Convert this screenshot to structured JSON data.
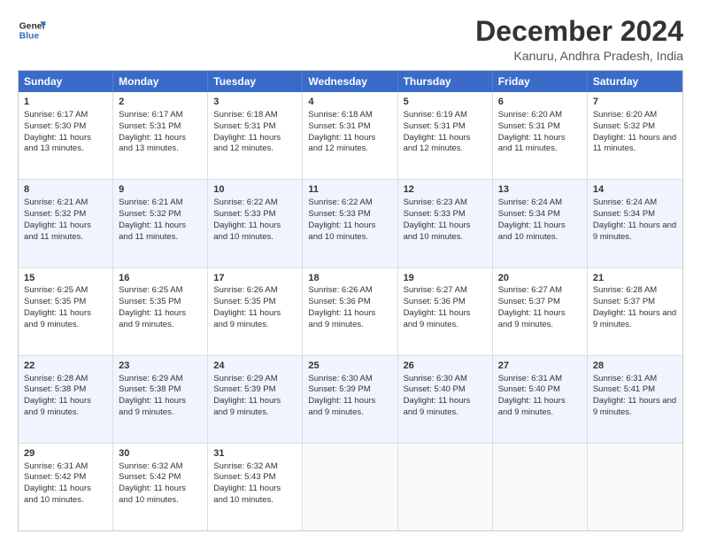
{
  "logo": {
    "line1": "General",
    "line2": "Blue"
  },
  "title": "December 2024",
  "subtitle": "Kanuru, Andhra Pradesh, India",
  "days": [
    "Sunday",
    "Monday",
    "Tuesday",
    "Wednesday",
    "Thursday",
    "Friday",
    "Saturday"
  ],
  "rows": [
    [
      {
        "day": "1",
        "sunrise": "Sunrise: 6:17 AM",
        "sunset": "Sunset: 5:30 PM",
        "daylight": "Daylight: 11 hours and 13 minutes."
      },
      {
        "day": "2",
        "sunrise": "Sunrise: 6:17 AM",
        "sunset": "Sunset: 5:31 PM",
        "daylight": "Daylight: 11 hours and 13 minutes."
      },
      {
        "day": "3",
        "sunrise": "Sunrise: 6:18 AM",
        "sunset": "Sunset: 5:31 PM",
        "daylight": "Daylight: 11 hours and 12 minutes."
      },
      {
        "day": "4",
        "sunrise": "Sunrise: 6:18 AM",
        "sunset": "Sunset: 5:31 PM",
        "daylight": "Daylight: 11 hours and 12 minutes."
      },
      {
        "day": "5",
        "sunrise": "Sunrise: 6:19 AM",
        "sunset": "Sunset: 5:31 PM",
        "daylight": "Daylight: 11 hours and 12 minutes."
      },
      {
        "day": "6",
        "sunrise": "Sunrise: 6:20 AM",
        "sunset": "Sunset: 5:31 PM",
        "daylight": "Daylight: 11 hours and 11 minutes."
      },
      {
        "day": "7",
        "sunrise": "Sunrise: 6:20 AM",
        "sunset": "Sunset: 5:32 PM",
        "daylight": "Daylight: 11 hours and 11 minutes."
      }
    ],
    [
      {
        "day": "8",
        "sunrise": "Sunrise: 6:21 AM",
        "sunset": "Sunset: 5:32 PM",
        "daylight": "Daylight: 11 hours and 11 minutes."
      },
      {
        "day": "9",
        "sunrise": "Sunrise: 6:21 AM",
        "sunset": "Sunset: 5:32 PM",
        "daylight": "Daylight: 11 hours and 11 minutes."
      },
      {
        "day": "10",
        "sunrise": "Sunrise: 6:22 AM",
        "sunset": "Sunset: 5:33 PM",
        "daylight": "Daylight: 11 hours and 10 minutes."
      },
      {
        "day": "11",
        "sunrise": "Sunrise: 6:22 AM",
        "sunset": "Sunset: 5:33 PM",
        "daylight": "Daylight: 11 hours and 10 minutes."
      },
      {
        "day": "12",
        "sunrise": "Sunrise: 6:23 AM",
        "sunset": "Sunset: 5:33 PM",
        "daylight": "Daylight: 11 hours and 10 minutes."
      },
      {
        "day": "13",
        "sunrise": "Sunrise: 6:24 AM",
        "sunset": "Sunset: 5:34 PM",
        "daylight": "Daylight: 11 hours and 10 minutes."
      },
      {
        "day": "14",
        "sunrise": "Sunrise: 6:24 AM",
        "sunset": "Sunset: 5:34 PM",
        "daylight": "Daylight: 11 hours and 9 minutes."
      }
    ],
    [
      {
        "day": "15",
        "sunrise": "Sunrise: 6:25 AM",
        "sunset": "Sunset: 5:35 PM",
        "daylight": "Daylight: 11 hours and 9 minutes."
      },
      {
        "day": "16",
        "sunrise": "Sunrise: 6:25 AM",
        "sunset": "Sunset: 5:35 PM",
        "daylight": "Daylight: 11 hours and 9 minutes."
      },
      {
        "day": "17",
        "sunrise": "Sunrise: 6:26 AM",
        "sunset": "Sunset: 5:35 PM",
        "daylight": "Daylight: 11 hours and 9 minutes."
      },
      {
        "day": "18",
        "sunrise": "Sunrise: 6:26 AM",
        "sunset": "Sunset: 5:36 PM",
        "daylight": "Daylight: 11 hours and 9 minutes."
      },
      {
        "day": "19",
        "sunrise": "Sunrise: 6:27 AM",
        "sunset": "Sunset: 5:36 PM",
        "daylight": "Daylight: 11 hours and 9 minutes."
      },
      {
        "day": "20",
        "sunrise": "Sunrise: 6:27 AM",
        "sunset": "Sunset: 5:37 PM",
        "daylight": "Daylight: 11 hours and 9 minutes."
      },
      {
        "day": "21",
        "sunrise": "Sunrise: 6:28 AM",
        "sunset": "Sunset: 5:37 PM",
        "daylight": "Daylight: 11 hours and 9 minutes."
      }
    ],
    [
      {
        "day": "22",
        "sunrise": "Sunrise: 6:28 AM",
        "sunset": "Sunset: 5:38 PM",
        "daylight": "Daylight: 11 hours and 9 minutes."
      },
      {
        "day": "23",
        "sunrise": "Sunrise: 6:29 AM",
        "sunset": "Sunset: 5:38 PM",
        "daylight": "Daylight: 11 hours and 9 minutes."
      },
      {
        "day": "24",
        "sunrise": "Sunrise: 6:29 AM",
        "sunset": "Sunset: 5:39 PM",
        "daylight": "Daylight: 11 hours and 9 minutes."
      },
      {
        "day": "25",
        "sunrise": "Sunrise: 6:30 AM",
        "sunset": "Sunset: 5:39 PM",
        "daylight": "Daylight: 11 hours and 9 minutes."
      },
      {
        "day": "26",
        "sunrise": "Sunrise: 6:30 AM",
        "sunset": "Sunset: 5:40 PM",
        "daylight": "Daylight: 11 hours and 9 minutes."
      },
      {
        "day": "27",
        "sunrise": "Sunrise: 6:31 AM",
        "sunset": "Sunset: 5:40 PM",
        "daylight": "Daylight: 11 hours and 9 minutes."
      },
      {
        "day": "28",
        "sunrise": "Sunrise: 6:31 AM",
        "sunset": "Sunset: 5:41 PM",
        "daylight": "Daylight: 11 hours and 9 minutes."
      }
    ],
    [
      {
        "day": "29",
        "sunrise": "Sunrise: 6:31 AM",
        "sunset": "Sunset: 5:42 PM",
        "daylight": "Daylight: 11 hours and 10 minutes."
      },
      {
        "day": "30",
        "sunrise": "Sunrise: 6:32 AM",
        "sunset": "Sunset: 5:42 PM",
        "daylight": "Daylight: 11 hours and 10 minutes."
      },
      {
        "day": "31",
        "sunrise": "Sunrise: 6:32 AM",
        "sunset": "Sunset: 5:43 PM",
        "daylight": "Daylight: 11 hours and 10 minutes."
      },
      null,
      null,
      null,
      null
    ]
  ]
}
